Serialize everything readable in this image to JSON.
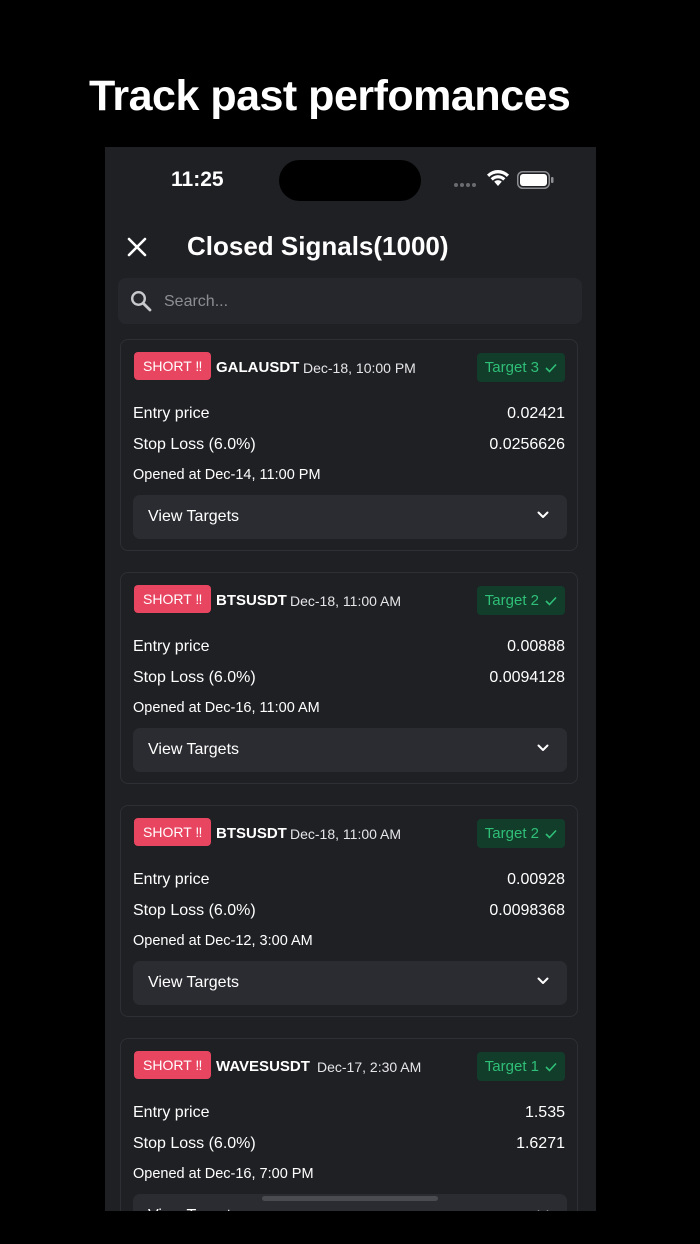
{
  "headline": "Track past perfomances",
  "status_bar": {
    "time": "11:25"
  },
  "nav": {
    "title": "Closed Signals(1000)"
  },
  "search": {
    "placeholder": "Search..."
  },
  "labels": {
    "entry_price": "Entry price",
    "view_targets": "View Targets"
  },
  "signals": [
    {
      "direction": "SHORT ‼",
      "pair": "GALAUSDT",
      "date": "Dec-18, 10:00 PM",
      "target": "Target 3",
      "entry_price": "0.02421",
      "stop_loss_label": "Stop Loss (6.0%)",
      "stop_loss": "0.0256626",
      "opened": "Opened at Dec-14, 11:00 PM"
    },
    {
      "direction": "SHORT ‼",
      "pair": "BTSUSDT",
      "date": "Dec-18, 11:00 AM",
      "target": "Target 2",
      "entry_price": "0.00888",
      "stop_loss_label": "Stop Loss (6.0%)",
      "stop_loss": "0.0094128",
      "opened": "Opened at Dec-16, 11:00 AM"
    },
    {
      "direction": "SHORT ‼",
      "pair": "BTSUSDT",
      "date": "Dec-18, 11:00 AM",
      "target": "Target 2",
      "entry_price": "0.00928",
      "stop_loss_label": "Stop Loss (6.0%)",
      "stop_loss": "0.0098368",
      "opened": "Opened at Dec-12, 3:00 AM"
    },
    {
      "direction": "SHORT ‼",
      "pair": "WAVESUSDT",
      "date": "Dec-17, 2:30 AM",
      "target": "Target 1",
      "entry_price": "1.535",
      "stop_loss_label": "Stop Loss (6.0%)",
      "stop_loss": "1.6271",
      "opened": "Opened at Dec-16, 7:00 PM"
    }
  ],
  "colors": {
    "short_badge": "#e84560",
    "target_badge_bg": "#123d2b",
    "target_text": "#2fbf77",
    "background": "#1f2024"
  }
}
